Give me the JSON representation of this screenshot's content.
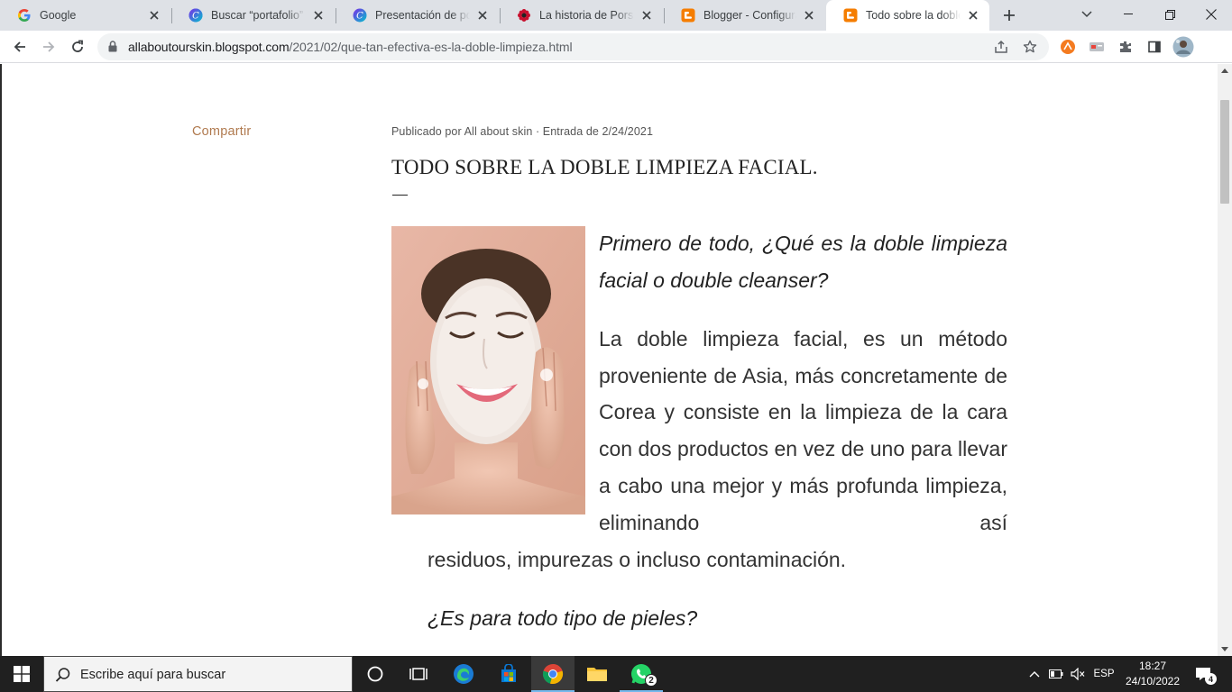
{
  "browser": {
    "tabs": [
      {
        "title": "Google",
        "favicon": "google-g-icon"
      },
      {
        "title": "Buscar “portafolio” - Canva",
        "favicon": "canva-icon"
      },
      {
        "title": "Presentación de portafolio",
        "favicon": "canva-icon"
      },
      {
        "title": "La historia de Porsche",
        "favicon": "porsche-flower-icon"
      },
      {
        "title": "Blogger - Configuración",
        "favicon": "blogger-icon"
      },
      {
        "title": "Todo sobre la doble limpieza facial",
        "favicon": "blogger-icon",
        "active": true
      }
    ],
    "new_tab_label": "+",
    "url_host": "allaboutourskin.blogspot.com",
    "url_path": "/2021/02/que-tan-efectiva-es-la-doble-limpieza.html"
  },
  "post": {
    "share_label": "Compartir",
    "byline": "Publicado por All about skin · Entrada de 2/24/2021",
    "title": "TODO SOBRE LA DOBLE LIMPIEZA FACIAL.",
    "question_1": "Primero de todo, ¿Qué es la doble limpieza facial o double cleanser?",
    "paragraph_1_start": "La doble limpieza facial, es un método proveniente de Asia, más concretamente de Corea y consiste en la limpieza de la cara con dos productos en vez de uno para llevar a cabo una mejor y más profunda limpieza, eliminando así",
    "paragraph_1_end": "residuos, impurezas o incluso contaminación.",
    "question_2": "¿Es para todo tipo de pieles?"
  },
  "taskbar": {
    "search_placeholder": "Escribe aquí para buscar",
    "whatsapp_badge": "2",
    "language": "ESP",
    "time": "18:27",
    "date": "24/10/2022",
    "notifications": "4"
  },
  "colors": {
    "accent_share": "#b07a4f",
    "tab_strip": "#dee1e6",
    "taskbar": "#202020"
  }
}
